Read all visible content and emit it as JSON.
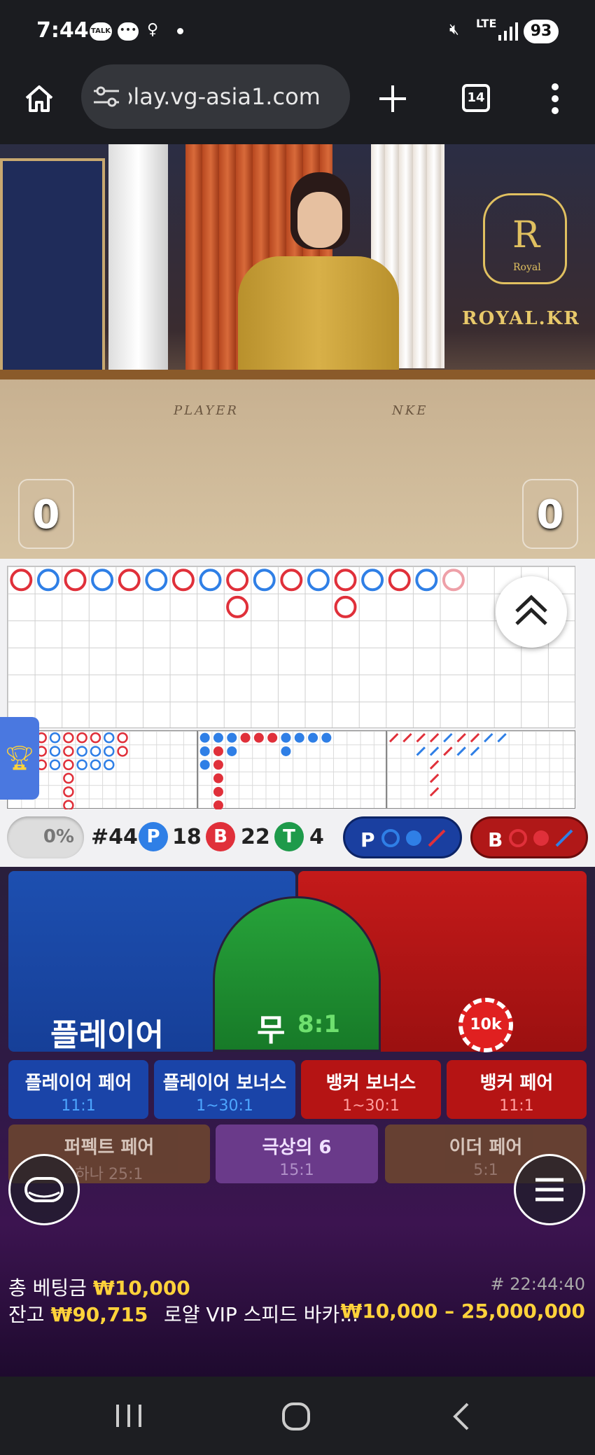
{
  "status_bar": {
    "time": "7:44",
    "network": "LTE",
    "battery": "93",
    "notification_icons": [
      "kakaotalk-icon",
      "chat-icon",
      "accessibility-icon",
      "dot-icon"
    ]
  },
  "browser": {
    "url": "play.vg-asia1.com",
    "tab_count": "14"
  },
  "video": {
    "player_score": "0",
    "banker_score": "0",
    "brand_text": "ROYAL.KR",
    "brand_sub": "Royal",
    "table_player_text": "PLAYER",
    "table_banker_text": "NKE"
  },
  "roadmap": {
    "bead_top_row": [
      "B",
      "P",
      "B",
      "P",
      "B",
      "P",
      "B",
      "P",
      "B",
      "P",
      "B",
      "P",
      "B",
      "P",
      "B",
      "P",
      "B"
    ],
    "bead_second_row": [
      "B",
      "B"
    ],
    "win_percent": "0%",
    "round": "#44",
    "player_label": "P",
    "player_count": "18",
    "banker_label": "B",
    "banker_count": "22",
    "tie_label": "T",
    "tie_count": "4",
    "ask_player_label": "P",
    "ask_banker_label": "B",
    "colors": {
      "player": "#2f7fe6",
      "banker": "#e0303a",
      "tie": "#1e9a4a"
    }
  },
  "betting": {
    "player_label": "플레이어",
    "tie_label": "무",
    "tie_odds": "8:1",
    "chip_value": "10k",
    "side_bets": [
      {
        "label": "플레이어 페어",
        "odds": "11:1"
      },
      {
        "label": "플레이어 보너스",
        "odds": "1~30:1"
      },
      {
        "label": "뱅커 보너스",
        "odds": "1~30:1"
      },
      {
        "label": "뱅커 페어",
        "odds": "11:1"
      }
    ],
    "special_bets": [
      {
        "label": "퍼펙트 페어",
        "odds": "하나 25:1"
      },
      {
        "label": "극상의 6",
        "odds": "15:1"
      },
      {
        "label": "이더 페어",
        "odds": "5:1"
      }
    ]
  },
  "info": {
    "total_bet_label": "총 베팅금",
    "total_bet_value": "₩10,000",
    "balance_label": "잔고",
    "balance_value": "₩90,715",
    "table_name": "로얄 VIP 스피드 바카...",
    "bet_limit": "₩10,000 – 25,000,000",
    "game_id": "# 22:44:40"
  }
}
